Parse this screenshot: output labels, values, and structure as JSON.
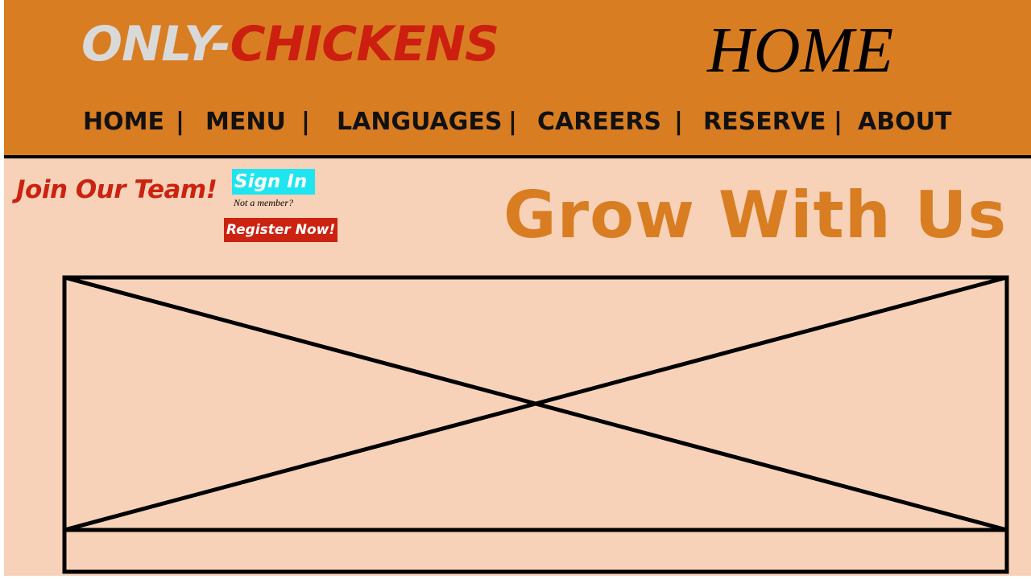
{
  "header": {
    "logo_part1": "ONLY-",
    "logo_part2": "CHICKENS",
    "page_heading": "HOME",
    "nav": [
      {
        "label": "HOME"
      },
      {
        "label": "MENU"
      },
      {
        "label": "LANGUAGES"
      },
      {
        "label": "CAREERS"
      },
      {
        "label": "RESERVE"
      },
      {
        "label": "ABOUT"
      }
    ],
    "separator": "|"
  },
  "careers": {
    "join_text": "Join Our Team!",
    "signin_label": "Sign In",
    "not_member_text": "Not a member?",
    "register_label": "Register Now!",
    "headline": "Grow With Us"
  },
  "colors": {
    "header_bg": "#d97d22",
    "page_bg": "#f7d2b8",
    "accent_red": "#cc2210",
    "signin_cyan": "#1ee5f0",
    "logo_gray": "#d9d9d9"
  },
  "icons": {
    "media_placeholder": "image-placeholder-icon"
  }
}
